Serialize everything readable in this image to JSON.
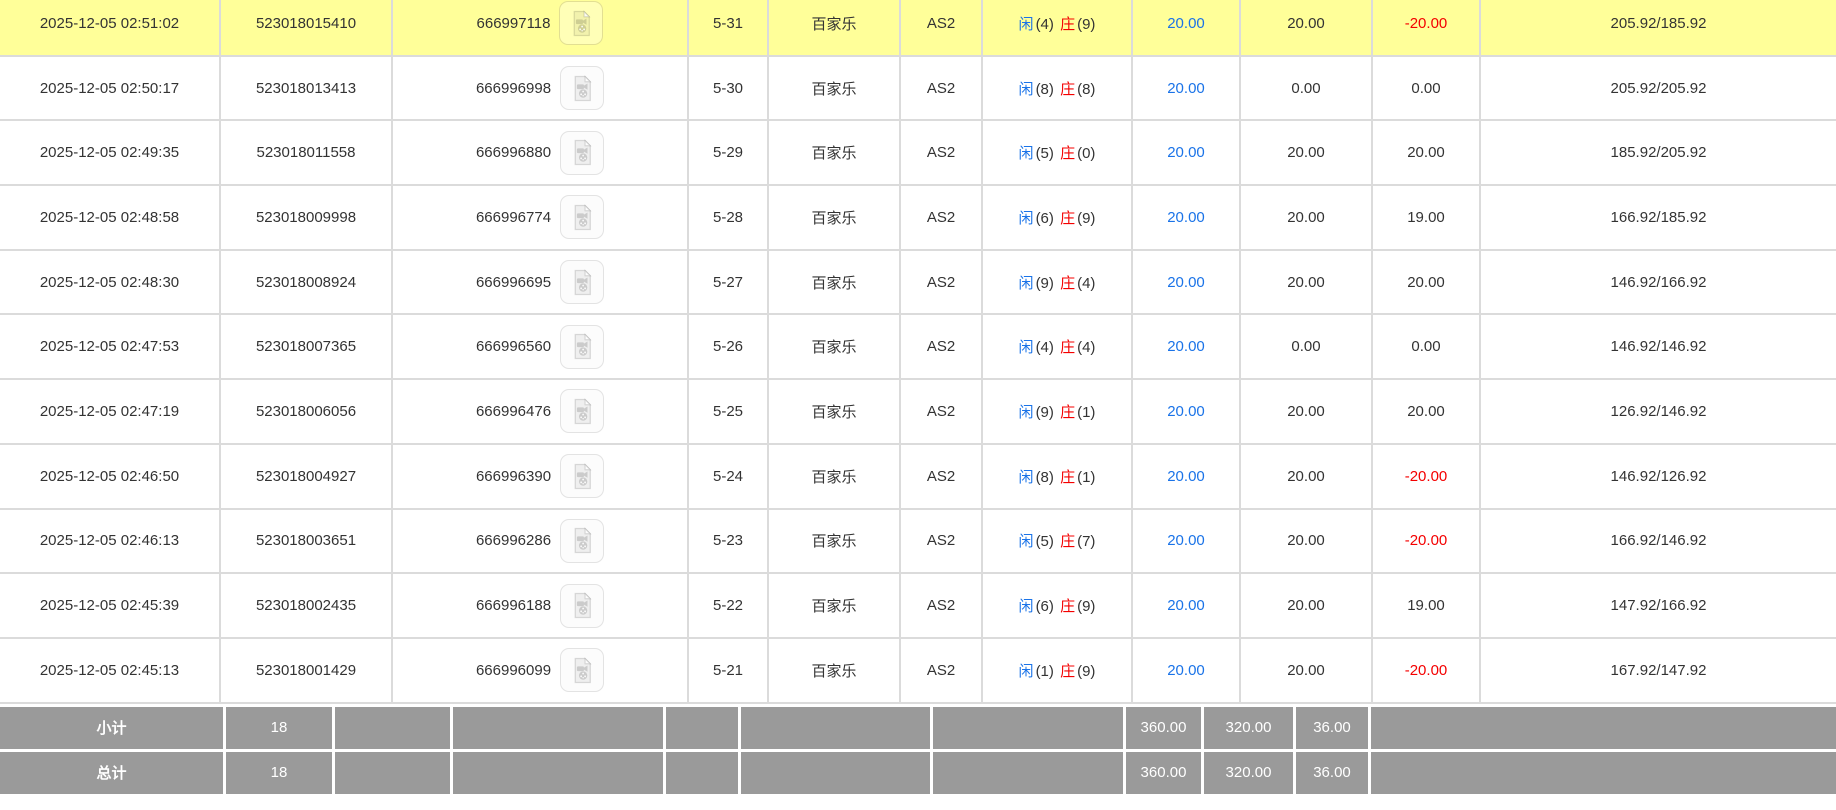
{
  "colors": {
    "row_highlight": "#ffff99",
    "footer_bg": "#9a9a9a",
    "link_blue": "#1a73e8",
    "loss_red": "#f40000",
    "border": "#dbdbdb"
  },
  "icons": {
    "video_replay": "video-file-icon"
  },
  "table": {
    "rows": [
      {
        "time": "2025-12-05 02:51:02",
        "bet_id": "523018015410",
        "game_id": "666997118",
        "round": "5-31",
        "game": "百家乐",
        "table": "AS2",
        "player_label": "闲",
        "player_score": "(4)",
        "banker_label": "庄",
        "banker_score": "(9)",
        "bet": "20.00",
        "valid": "20.00",
        "win": "-20.00",
        "balance": "205.92/185.92",
        "highlighted": true
      },
      {
        "time": "2025-12-05 02:50:17",
        "bet_id": "523018013413",
        "game_id": "666996998",
        "round": "5-30",
        "game": "百家乐",
        "table": "AS2",
        "player_label": "闲",
        "player_score": "(8)",
        "banker_label": "庄",
        "banker_score": "(8)",
        "bet": "20.00",
        "valid": "0.00",
        "win": "0.00",
        "balance": "205.92/205.92",
        "highlighted": false
      },
      {
        "time": "2025-12-05 02:49:35",
        "bet_id": "523018011558",
        "game_id": "666996880",
        "round": "5-29",
        "game": "百家乐",
        "table": "AS2",
        "player_label": "闲",
        "player_score": "(5)",
        "banker_label": "庄",
        "banker_score": "(0)",
        "bet": "20.00",
        "valid": "20.00",
        "win": "20.00",
        "balance": "185.92/205.92",
        "highlighted": false
      },
      {
        "time": "2025-12-05 02:48:58",
        "bet_id": "523018009998",
        "game_id": "666996774",
        "round": "5-28",
        "game": "百家乐",
        "table": "AS2",
        "player_label": "闲",
        "player_score": "(6)",
        "banker_label": "庄",
        "banker_score": "(9)",
        "bet": "20.00",
        "valid": "20.00",
        "win": "19.00",
        "balance": "166.92/185.92",
        "highlighted": false
      },
      {
        "time": "2025-12-05 02:48:30",
        "bet_id": "523018008924",
        "game_id": "666996695",
        "round": "5-27",
        "game": "百家乐",
        "table": "AS2",
        "player_label": "闲",
        "player_score": "(9)",
        "banker_label": "庄",
        "banker_score": "(4)",
        "bet": "20.00",
        "valid": "20.00",
        "win": "20.00",
        "balance": "146.92/166.92",
        "highlighted": false
      },
      {
        "time": "2025-12-05 02:47:53",
        "bet_id": "523018007365",
        "game_id": "666996560",
        "round": "5-26",
        "game": "百家乐",
        "table": "AS2",
        "player_label": "闲",
        "player_score": "(4)",
        "banker_label": "庄",
        "banker_score": "(4)",
        "bet": "20.00",
        "valid": "0.00",
        "win": "0.00",
        "balance": "146.92/146.92",
        "highlighted": false
      },
      {
        "time": "2025-12-05 02:47:19",
        "bet_id": "523018006056",
        "game_id": "666996476",
        "round": "5-25",
        "game": "百家乐",
        "table": "AS2",
        "player_label": "闲",
        "player_score": "(9)",
        "banker_label": "庄",
        "banker_score": "(1)",
        "bet": "20.00",
        "valid": "20.00",
        "win": "20.00",
        "balance": "126.92/146.92",
        "highlighted": false
      },
      {
        "time": "2025-12-05 02:46:50",
        "bet_id": "523018004927",
        "game_id": "666996390",
        "round": "5-24",
        "game": "百家乐",
        "table": "AS2",
        "player_label": "闲",
        "player_score": "(8)",
        "banker_label": "庄",
        "banker_score": "(1)",
        "bet": "20.00",
        "valid": "20.00",
        "win": "-20.00",
        "balance": "146.92/126.92",
        "highlighted": false
      },
      {
        "time": "2025-12-05 02:46:13",
        "bet_id": "523018003651",
        "game_id": "666996286",
        "round": "5-23",
        "game": "百家乐",
        "table": "AS2",
        "player_label": "闲",
        "player_score": "(5)",
        "banker_label": "庄",
        "banker_score": "(7)",
        "bet": "20.00",
        "valid": "20.00",
        "win": "-20.00",
        "balance": "166.92/146.92",
        "highlighted": false
      },
      {
        "time": "2025-12-05 02:45:39",
        "bet_id": "523018002435",
        "game_id": "666996188",
        "round": "5-22",
        "game": "百家乐",
        "table": "AS2",
        "player_label": "闲",
        "player_score": "(6)",
        "banker_label": "庄",
        "banker_score": "(9)",
        "bet": "20.00",
        "valid": "20.00",
        "win": "19.00",
        "balance": "147.92/166.92",
        "highlighted": false
      },
      {
        "time": "2025-12-05 02:45:13",
        "bet_id": "523018001429",
        "game_id": "666996099",
        "round": "5-21",
        "game": "百家乐",
        "table": "AS2",
        "player_label": "闲",
        "player_score": "(1)",
        "banker_label": "庄",
        "banker_score": "(9)",
        "bet": "20.00",
        "valid": "20.00",
        "win": "-20.00",
        "balance": "167.92/147.92",
        "highlighted": false
      }
    ],
    "footer": [
      {
        "label": "小计",
        "count": "18",
        "bet": "360.00",
        "valid": "320.00",
        "win": "36.00"
      },
      {
        "label": "总计",
        "count": "18",
        "bet": "360.00",
        "valid": "320.00",
        "win": "36.00"
      }
    ]
  }
}
